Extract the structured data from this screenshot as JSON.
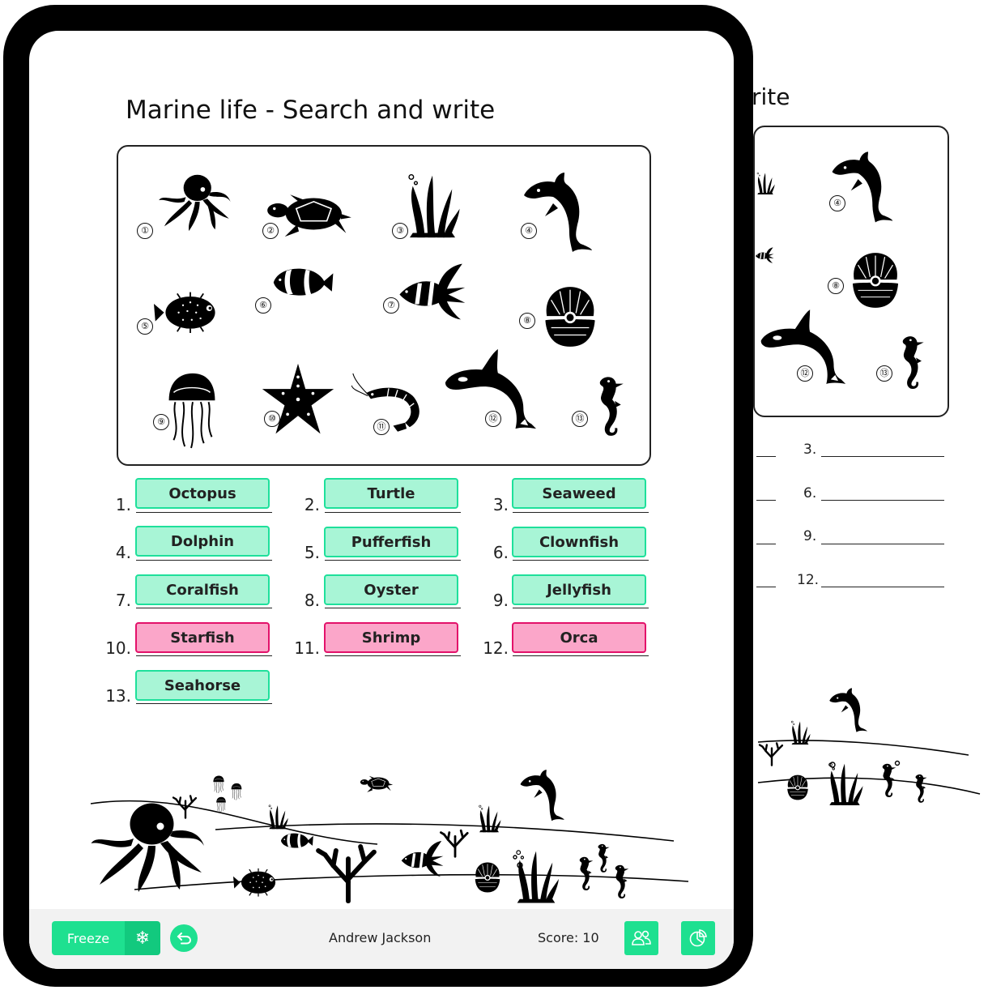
{
  "worksheet": {
    "title": "Marine life - Search and write",
    "back_title_fragment": "rite"
  },
  "pictures": [
    {
      "num": "①",
      "name": "octopus-icon"
    },
    {
      "num": "②",
      "name": "turtle-icon"
    },
    {
      "num": "③",
      "name": "seaweed-icon"
    },
    {
      "num": "④",
      "name": "dolphin-icon"
    },
    {
      "num": "⑤",
      "name": "pufferfish-icon"
    },
    {
      "num": "⑥",
      "name": "clownfish-icon"
    },
    {
      "num": "⑦",
      "name": "coralfish-icon"
    },
    {
      "num": "⑧",
      "name": "oyster-icon"
    },
    {
      "num": "⑨",
      "name": "jellyfish-icon"
    },
    {
      "num": "⑩",
      "name": "starfish-icon"
    },
    {
      "num": "⑪",
      "name": "shrimp-icon"
    },
    {
      "num": "⑫",
      "name": "orca-icon"
    },
    {
      "num": "⑬",
      "name": "seahorse-icon"
    }
  ],
  "answers": [
    {
      "num": "1.",
      "text": "Octopus",
      "status": "correct"
    },
    {
      "num": "2.",
      "text": "Turtle",
      "status": "correct"
    },
    {
      "num": "3.",
      "text": "Seaweed",
      "status": "correct"
    },
    {
      "num": "4.",
      "text": "Dolphin",
      "status": "correct"
    },
    {
      "num": "5.",
      "text": "Pufferfish",
      "status": "correct"
    },
    {
      "num": "6.",
      "text": "Clownfish",
      "status": "correct"
    },
    {
      "num": "7.",
      "text": "Coralfish",
      "status": "correct"
    },
    {
      "num": "8.",
      "text": "Oyster",
      "status": "correct"
    },
    {
      "num": "9.",
      "text": "Jellyfish",
      "status": "correct"
    },
    {
      "num": "10.",
      "text": "Starfish",
      "status": "incorrect"
    },
    {
      "num": "11.",
      "text": "Shrimp",
      "status": "incorrect"
    },
    {
      "num": "12.",
      "text": "Orca",
      "status": "incorrect"
    },
    {
      "num": "13.",
      "text": "Seahorse",
      "status": "correct"
    }
  ],
  "back_page": {
    "pictures": [
      {
        "num": "④",
        "name": "dolphin-icon"
      },
      {
        "num": "⑧",
        "name": "oyster-icon"
      },
      {
        "num": "⑫",
        "name": "orca-icon"
      },
      {
        "num": "⑬",
        "name": "seahorse-icon"
      }
    ],
    "line_numbers": [
      "3.",
      "6.",
      "9.",
      "12."
    ]
  },
  "toolbar": {
    "freeze_label": "Freeze",
    "student_name": "Andrew Jackson",
    "score_text": "Score: 10"
  },
  "colors": {
    "correct_fill": "#a8f5d6",
    "correct_border": "#1ee09b",
    "incorrect_fill": "#fba6c9",
    "incorrect_border": "#e3126a",
    "accent": "#1ee090"
  }
}
